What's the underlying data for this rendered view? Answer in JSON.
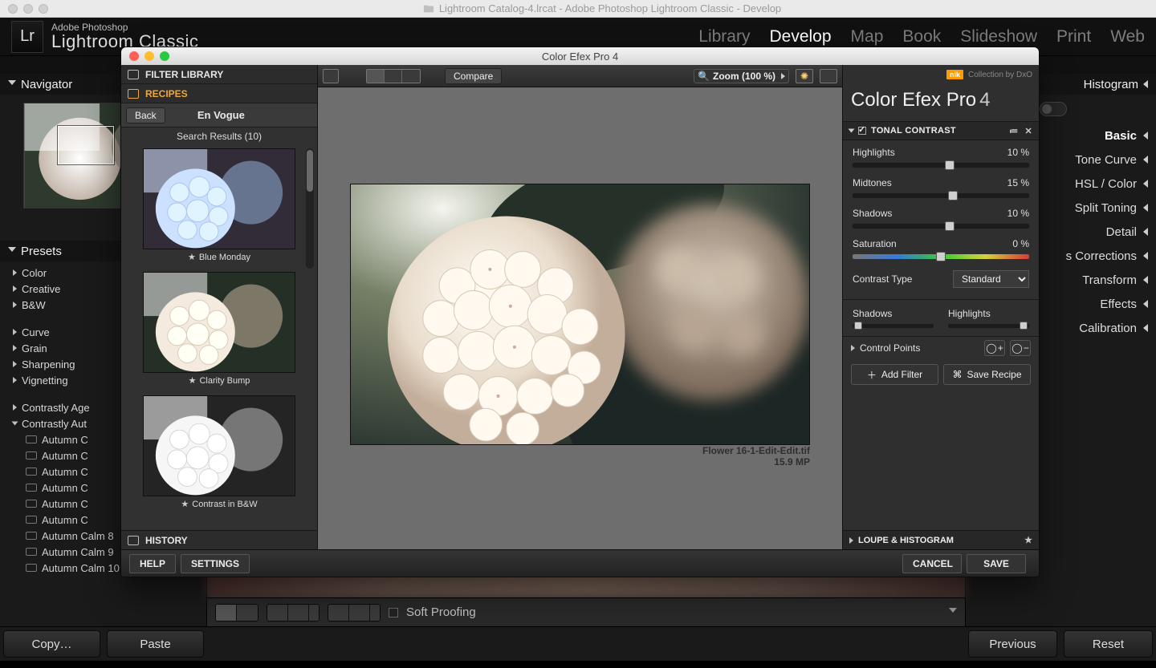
{
  "mac": {
    "title": "Lightroom Catalog-4.lrcat - Adobe Photoshop Lightroom Classic - Develop"
  },
  "lr": {
    "brand1": "Adobe Photoshop",
    "brand2": "Lightroom Classic",
    "modules": [
      "Library",
      "Develop",
      "Map",
      "Book",
      "Slideshow",
      "Print",
      "Web"
    ],
    "selected_module": "Develop",
    "navigator": "Navigator",
    "presets": "Presets",
    "preset_groups": [
      "Color",
      "Creative",
      "B&W"
    ],
    "preset_groups2": [
      "Curve",
      "Grain",
      "Sharpening",
      "Vignetting"
    ],
    "preset_user1": "Contrastly Age",
    "preset_user2": "Contrastly Aut",
    "preset_items": [
      "Autumn C",
      "Autumn C",
      "Autumn C",
      "Autumn C",
      "Autumn C",
      "Autumn C",
      "Autumn Calm 8",
      "Autumn Calm 9",
      "Autumn Calm 10"
    ],
    "copy": "Copy…",
    "paste": "Paste",
    "previous": "Previous",
    "reset": "Reset",
    "soft_proof": "Soft Proofing",
    "right": {
      "histogram": "Histogram",
      "panels": [
        "Basic",
        "Tone Curve",
        "HSL / Color",
        "Split Toning",
        "Detail",
        "s Corrections",
        "Transform",
        "Effects",
        "Calibration"
      ]
    }
  },
  "cef": {
    "title": "Color Efex Pro 4",
    "filter_library": "FILTER LIBRARY",
    "recipes": "RECIPES",
    "back": "Back",
    "breadcrumb": "En Vogue",
    "results": "Search Results (10)",
    "thumbs": [
      "Blue Monday",
      "Clarity Bump",
      "Contrast in B&W"
    ],
    "history": "HISTORY",
    "compare": "Compare",
    "zoom": "Zoom (100 %)",
    "filename": "Flower 16-1-Edit-Edit.tif",
    "megapixels": "15.9 MP",
    "brand": "Collection by DxO",
    "logo": "Color Efex Pro",
    "logo_v": "4",
    "section": "TONAL CONTRAST",
    "sliders": {
      "highlights": {
        "label": "Highlights",
        "value": "10 %",
        "pos": 55
      },
      "midtones": {
        "label": "Midtones",
        "value": "15 %",
        "pos": 57
      },
      "shadows": {
        "label": "Shadows",
        "value": "10 %",
        "pos": 55
      },
      "saturation": {
        "label": "Saturation",
        "value": "0 %",
        "pos": 50
      }
    },
    "contrast_type_label": "Contrast Type",
    "contrast_type_value": "Standard",
    "mini": {
      "shadows": "Shadows",
      "highlights": "Highlights"
    },
    "control_points": "Control Points",
    "add_filter": "Add Filter",
    "save_recipe": "Save Recipe",
    "loupe": "LOUPE & HISTOGRAM",
    "help": "HELP",
    "settings": "SETTINGS",
    "cancel": "CANCEL",
    "save": "SAVE"
  }
}
